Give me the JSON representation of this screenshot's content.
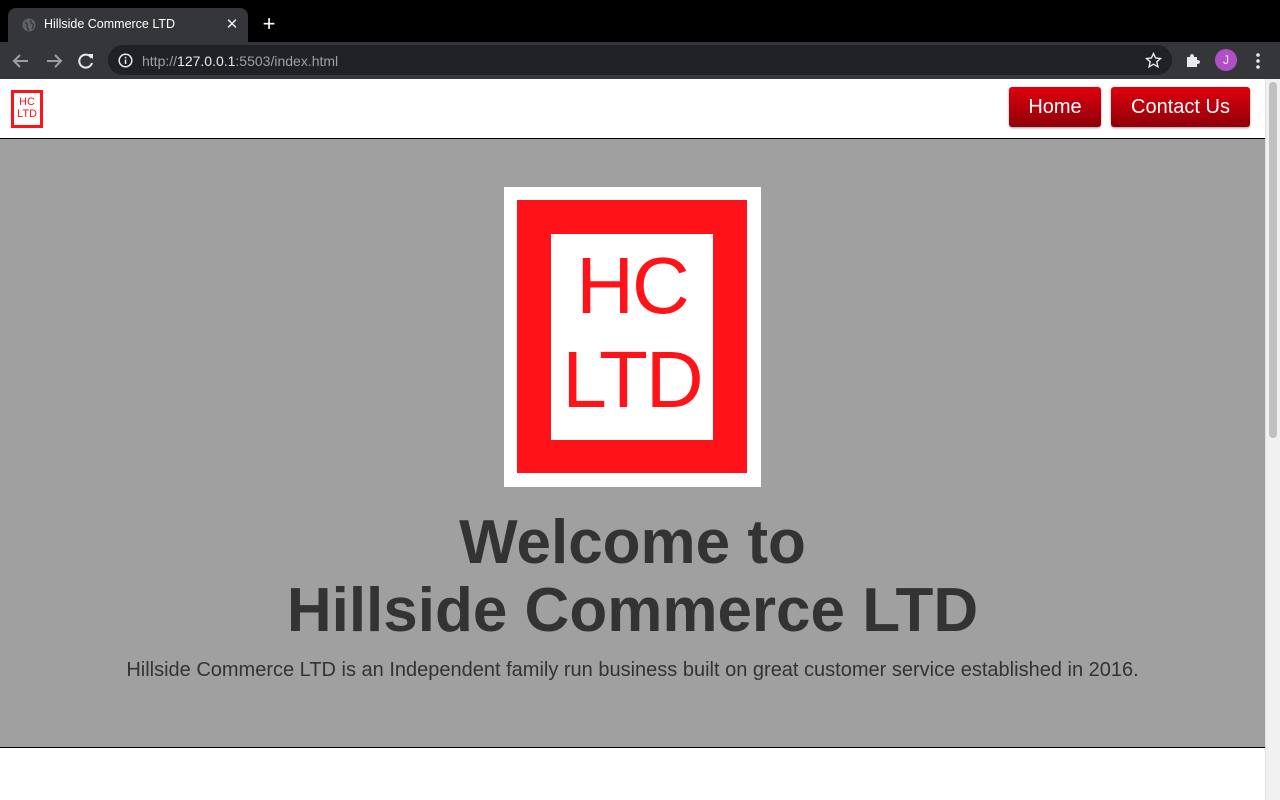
{
  "browser": {
    "tab_title": "Hillside Commerce LTD",
    "tab_close": "✕",
    "new_tab": "+",
    "url_scheme": "http://",
    "url_host": "127.0.0.1",
    "url_rest": ":5503/index.html",
    "profile_initial": "J"
  },
  "header": {
    "logo_line1": "HC",
    "logo_line2": "LTD",
    "nav": [
      {
        "label": "Home"
      },
      {
        "label": "Contact Us"
      }
    ]
  },
  "hero": {
    "logo_line1": "HC",
    "logo_line2": "LTD",
    "title_line1": "Welcome to",
    "title_line2": "Hillside Commerce LTD",
    "subtitle": "Hillside Commerce LTD is an Independent family run business built on great customer service established in 2016."
  },
  "colors": {
    "brand_red": "#ff1218",
    "hero_bg": "#a0a0a0",
    "button_top": "#e0000d",
    "button_bottom": "#8e000a",
    "text_dark": "#333333"
  }
}
